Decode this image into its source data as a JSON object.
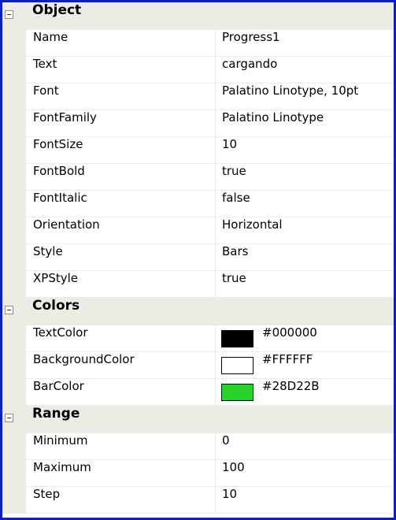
{
  "categories": [
    {
      "title": "Object",
      "rows": [
        {
          "name": "Name",
          "value": "Progress1"
        },
        {
          "name": "Text",
          "value": "cargando"
        },
        {
          "name": "Font",
          "value": "Palatino Linotype, 10pt"
        },
        {
          "name": "FontFamily",
          "value": "Palatino Linotype"
        },
        {
          "name": "FontSize",
          "value": "10"
        },
        {
          "name": "FontBold",
          "value": "true"
        },
        {
          "name": "FontItalic",
          "value": "false"
        },
        {
          "name": "Orientation",
          "value": "Horizontal"
        },
        {
          "name": "Style",
          "value": "Bars"
        },
        {
          "name": "XPStyle",
          "value": "true"
        }
      ]
    },
    {
      "title": "Colors",
      "rows": [
        {
          "name": "TextColor",
          "value": "#000000",
          "swatch": "#000000"
        },
        {
          "name": "BackgroundColor",
          "value": "#FFFFFF",
          "swatch": "#FFFFFF"
        },
        {
          "name": "BarColor",
          "value": "#28D22B",
          "swatch": "#28D22B"
        }
      ]
    },
    {
      "title": "Range",
      "rows": [
        {
          "name": "Minimum",
          "value": "0"
        },
        {
          "name": "Maximum",
          "value": "100"
        },
        {
          "name": "Step",
          "value": "10"
        }
      ]
    }
  ]
}
